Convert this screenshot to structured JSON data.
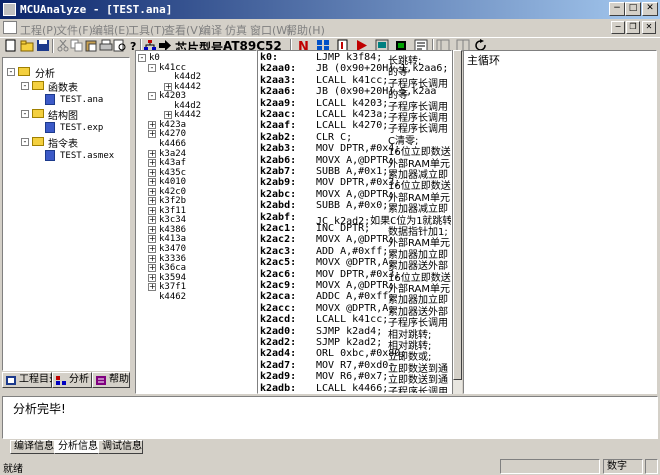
{
  "window": {
    "title": "MCUAnalyze - [TEST.ana]",
    "colors": {
      "titlebar_start": "#0a246a",
      "titlebar_end": "#a6caf0",
      "face": "#d4d0c8"
    }
  },
  "menu": [
    "工程(P)",
    "文件(F)",
    "编辑(E)",
    "工具(T)",
    "查看(V)",
    "编译",
    "仿真",
    "窗口(W)",
    "帮助(H)"
  ],
  "toolbar": {
    "icons": [
      "new-icon",
      "open-icon",
      "save-icon",
      "cut-icon",
      "copy-icon",
      "paste-icon",
      "print-icon",
      "preview-icon",
      "help-icon",
      "tree-icon",
      "forward-icon",
      "compile-icon",
      "build-icon",
      "step-icon",
      "run-icon",
      "break-icon",
      "chip-icon",
      "option-icon",
      "refresh-icon"
    ],
    "chip_label": "芯片型号:",
    "chip_value": "AT89C52"
  },
  "project_tree": [
    {
      "label": "分析",
      "level": 0,
      "type": "folder",
      "expander": "-"
    },
    {
      "label": "函数表",
      "level": 1,
      "type": "folder",
      "expander": "-"
    },
    {
      "label": "TEST.ana",
      "level": 2,
      "type": "doc"
    },
    {
      "label": "结构图",
      "level": 1,
      "type": "folder",
      "expander": "-"
    },
    {
      "label": "TEST.exp",
      "level": 2,
      "type": "doc"
    },
    {
      "label": "指令表",
      "level": 1,
      "type": "folder",
      "expander": "-"
    },
    {
      "label": "TEST.asmex",
      "level": 2,
      "type": "doc"
    }
  ],
  "left_tabs": [
    {
      "label": "工程目录",
      "icon": "project-icon"
    },
    {
      "label": "分析",
      "icon": "analysis-icon"
    },
    {
      "label": "帮助",
      "icon": "help-book-icon"
    }
  ],
  "func_tree": [
    {
      "label": "k0",
      "level": 0,
      "expander": "-"
    },
    {
      "label": "k41cc",
      "level": 1,
      "expander": "-"
    },
    {
      "label": "k44d2",
      "level": 2
    },
    {
      "label": "k4442",
      "level": 2,
      "expander": "+"
    },
    {
      "label": "k4203",
      "level": 1,
      "expander": "-"
    },
    {
      "label": "k44d2",
      "level": 2
    },
    {
      "label": "k4442",
      "level": 2,
      "expander": "+"
    },
    {
      "label": "k423a",
      "level": 1,
      "expander": "+"
    },
    {
      "label": "k4270",
      "level": 1,
      "expander": "+"
    },
    {
      "label": "k4466",
      "level": 1
    },
    {
      "label": "k3a24",
      "level": 1,
      "expander": "+"
    },
    {
      "label": "k43af",
      "level": 1,
      "expander": "+"
    },
    {
      "label": "k435c",
      "level": 1,
      "expander": "+"
    },
    {
      "label": "k4010",
      "level": 1,
      "expander": "+"
    },
    {
      "label": "k42c0",
      "level": 1,
      "expander": "+"
    },
    {
      "label": "k3f2b",
      "level": 1,
      "expander": "+"
    },
    {
      "label": "k3f11",
      "level": 1,
      "expander": "+"
    },
    {
      "label": "k3c34",
      "level": 1,
      "expander": "+"
    },
    {
      "label": "k4386",
      "level": 1,
      "expander": "+"
    },
    {
      "label": "k413a",
      "level": 1,
      "expander": "+"
    },
    {
      "label": "k3470",
      "level": 1,
      "expander": "+"
    },
    {
      "label": "k3336",
      "level": 1,
      "expander": "+"
    },
    {
      "label": "k36ca",
      "level": 1,
      "expander": "+"
    },
    {
      "label": "k3594",
      "level": 1,
      "expander": "+"
    },
    {
      "label": "k37f1",
      "level": 1,
      "expander": "+"
    },
    {
      "label": "k4462",
      "level": 1
    }
  ],
  "asm": [
    {
      "addr": "k0:",
      "instr": "LJMP k3f84;",
      "note": "长跳转;"
    },
    {
      "addr": "k2aa0:",
      "instr": "JB (0x90+20H).1,k2aa6;",
      "note": "的等"
    },
    {
      "addr": "k2aa3:",
      "instr": "LCALL k41cc;",
      "note": "子程序长调用"
    },
    {
      "addr": "k2aa6:",
      "instr": "JB (0x90+20H).5,k2aa",
      "note": "的等"
    },
    {
      "addr": "k2aa9:",
      "instr": "LCALL k4203;",
      "note": "子程序长调用"
    },
    {
      "addr": "k2aac:",
      "instr": "LCALL k423a;",
      "note": "子程序长调用"
    },
    {
      "addr": "k2aaf:",
      "instr": "LCALL k4270;",
      "note": "子程序长调用"
    },
    {
      "addr": "k2ab2:",
      "instr": "CLR C;",
      "note": "C清零;"
    },
    {
      "addr": "k2ab3:",
      "instr": "MOV DPTR,#0x4;",
      "note": "16位立即数送"
    },
    {
      "addr": "k2ab6:",
      "instr": "MOVX A,@DPTR;",
      "note": "外部RAM单元"
    },
    {
      "addr": "k2ab7:",
      "instr": "SUBB A,#0x1;",
      "note": "累加器减立即"
    },
    {
      "addr": "k2ab9:",
      "instr": "MOV DPTR,#0x3;",
      "note": "16位立即数送"
    },
    {
      "addr": "k2abc:",
      "instr": "MOVX A,@DPTR;",
      "note": "外部RAM单元"
    },
    {
      "addr": "k2abd:",
      "instr": "SUBB A,#0x0;",
      "note": "累加器减立即"
    },
    {
      "addr": "k2abf:",
      "instr": "JC k2ad2;如果C位为1就跳转;",
      "note": ""
    },
    {
      "addr": "k2ac1:",
      "instr": "INC DPTR;",
      "note": "数据指针加1;"
    },
    {
      "addr": "k2ac2:",
      "instr": "MOVX A,@DPTR;",
      "note": "外部RAM单元"
    },
    {
      "addr": "k2ac3:",
      "instr": "ADD A,#0xff;",
      "note": "累加器加立即"
    },
    {
      "addr": "k2ac5:",
      "instr": "MOVX @DPTR,A;",
      "note": "累加器送外部"
    },
    {
      "addr": "k2ac6:",
      "instr": "MOV DPTR,#0x3;",
      "note": "16位立即数送"
    },
    {
      "addr": "k2ac9:",
      "instr": "MOVX A,@DPTR;",
      "note": "外部RAM单元"
    },
    {
      "addr": "k2aca:",
      "instr": "ADDC A,#0xff;",
      "note": "累加器加立即"
    },
    {
      "addr": "k2acc:",
      "instr": "MOVX @DPTR,A;",
      "note": "累加器送外部"
    },
    {
      "addr": "k2acd:",
      "instr": "LCALL k41cc;",
      "note": "子程序长调用"
    },
    {
      "addr": "k2ad0:",
      "instr": "SJMP k2ad4;",
      "note": "相对跳转;"
    },
    {
      "addr": "k2ad2:",
      "instr": "SJMP k2ad2;",
      "note": "相对跳转;"
    },
    {
      "addr": "k2ad4:",
      "instr": "ORL 0xbc,#0x80;",
      "note": "立即数或;"
    },
    {
      "addr": "k2ad7:",
      "instr": "MOV R7,#0xd0;",
      "note": "立即数送到通"
    },
    {
      "addr": "k2ad9:",
      "instr": "MOV R6,#0x7;",
      "note": "立即数送到通"
    },
    {
      "addr": "k2adb:",
      "instr": "LCALL k4466;",
      "note": "子程序长调用"
    }
  ],
  "note_pane": {
    "text": "主循环"
  },
  "output": {
    "text": "分析完毕!"
  },
  "output_tabs": [
    {
      "label": "编译信息",
      "active": false
    },
    {
      "label": "分析信息",
      "active": true
    },
    {
      "label": "调试信息",
      "active": false
    }
  ],
  "status": {
    "left": "就绪",
    "num": "数字"
  }
}
